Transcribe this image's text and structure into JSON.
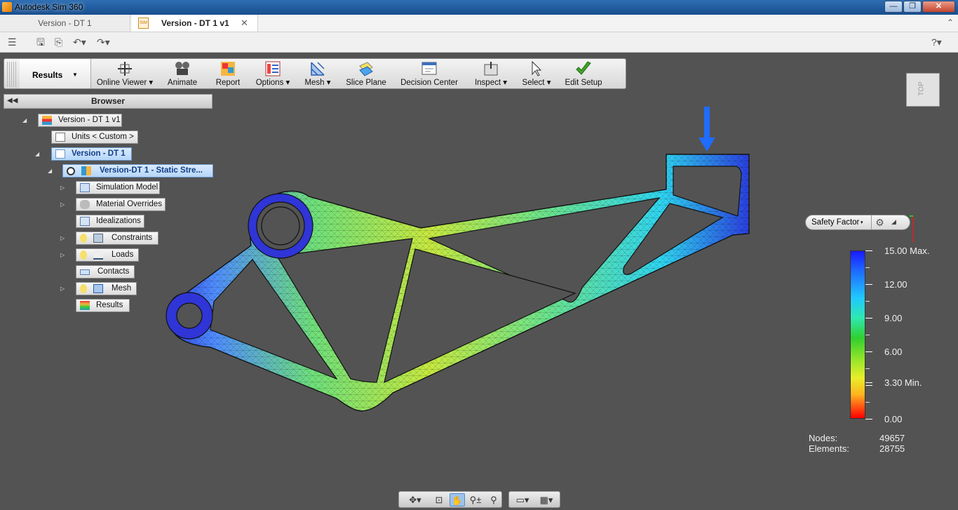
{
  "window": {
    "title": "Autodesk Sim 360",
    "min": "—",
    "max": "❐",
    "close": "✕"
  },
  "tabs": [
    {
      "label": "Version - DT 1"
    },
    {
      "label": "Version - DT 1 v1",
      "close": "✕"
    }
  ],
  "quick_access": {
    "menu": "☰",
    "save": "🖫",
    "save_as": "⎘",
    "undo": "↶▾",
    "redo": "↷▾",
    "help": "?▾",
    "collapse": "⌃"
  },
  "ribbon": {
    "environment": "Results",
    "env_caret": "▼",
    "buttons": [
      {
        "label": "Online Viewer ▾",
        "icon": "online-viewer-icon"
      },
      {
        "label": "Animate",
        "icon": "animate-icon"
      },
      {
        "label": "Report",
        "icon": "report-icon"
      },
      {
        "label": "Options ▾",
        "icon": "options-icon"
      },
      {
        "label": "Mesh ▾",
        "icon": "mesh-icon"
      },
      {
        "label": "Slice Plane",
        "icon": "slice-plane-icon"
      },
      {
        "label": "Decision Center",
        "icon": "decision-center-icon"
      },
      {
        "label": "Inspect ▾",
        "icon": "inspect-icon"
      },
      {
        "label": "Select ▾",
        "icon": "select-icon"
      },
      {
        "label": "Edit Setup",
        "icon": "check-icon"
      }
    ]
  },
  "browser": {
    "title": "Browser",
    "rewind": "◀◀",
    "nodes": [
      {
        "label": "Version - DT 1 v1"
      },
      {
        "label": "Units < Custom >"
      },
      {
        "label": "Version - DT 1"
      },
      {
        "label": "Version-DT 1 - Static Stre..."
      },
      {
        "label": "Simulation Model"
      },
      {
        "label": "Material Overrides"
      },
      {
        "label": "Idealizations"
      },
      {
        "label": "Constraints"
      },
      {
        "label": "Loads"
      },
      {
        "label": "Contacts"
      },
      {
        "label": "Mesh"
      },
      {
        "label": "Results"
      }
    ]
  },
  "viewcube": {
    "face": "TOP"
  },
  "legend": {
    "result_type": "Safety Factor",
    "caret": "▾",
    "gear": "⚙",
    "triangle": "◢",
    "labels": [
      "15.00 Max.",
      "12.00",
      "9.00",
      "6.00",
      "3.30 Min.",
      "0.00"
    ],
    "min_value": 0,
    "max_value": 15,
    "actual_min": 3.3,
    "actual_max": 15.0
  },
  "stats": {
    "nodes_label": "Nodes:",
    "nodes_value": "49657",
    "elements_label": "Elements:",
    "elements_value": "28755"
  },
  "navbar": {
    "orbit": "✥▾",
    "look_at": "⊡",
    "pan": "✋",
    "zoom": "⚲±",
    "fit": "⚲",
    "display": "▭▾",
    "grid": "▦▾"
  }
}
